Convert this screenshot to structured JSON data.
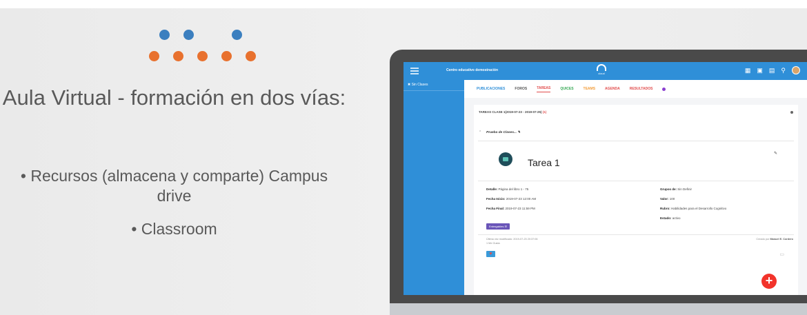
{
  "slide": {
    "title": "Aula Virtual - formación en dos vías:",
    "bullets": [
      "• Recursos (almacena y comparte) Campus drive",
      "• Classroom"
    ],
    "dot_colors": {
      "blue": "#3b7fbf",
      "orange": "#e8712e"
    }
  },
  "app": {
    "topbar": {
      "center_name": "Centro educativo demostración",
      "logo_text": "cloud",
      "icons": [
        "grid-icon",
        "doc-icon",
        "calendar-icon",
        "search-icon",
        "avatar"
      ],
      "color": "#2f8fd8"
    },
    "sidebar": {
      "items": [
        {
          "label": "Sin Clases",
          "icon": "x-icon"
        }
      ]
    },
    "tabs": [
      {
        "label": "PUBLICACIONES",
        "color": "#2f8fd8"
      },
      {
        "label": "FOROS",
        "color": "#555555"
      },
      {
        "label": "TAREAS",
        "color": "#e14b4b"
      },
      {
        "label": "QUICES",
        "color": "#34a853"
      },
      {
        "label": "TEAMS",
        "color": "#f29c38"
      },
      {
        "label": "AGENDA",
        "color": "#e14b4b"
      },
      {
        "label": "RESULTADOS",
        "color": "#e14b4b"
      }
    ],
    "card": {
      "header": "TAREAS CLASE 1(2019-07-23 - 2019-07-25)",
      "header_count": "(1)",
      "subtitle": "Prueba de Clases...",
      "task_title": "Tarea 1",
      "details_left": [
        {
          "label": "Detalle:",
          "value": "Página del libro 1 - 75"
        },
        {
          "label": "Fecha Inicio:",
          "value": "2019-07-23 12:00 AM"
        },
        {
          "label": "Fecha Final:",
          "value": "2019-07-23 11:59 PM"
        }
      ],
      "details_right": [
        {
          "label": "Grupos de:",
          "value": "Sin Definir"
        },
        {
          "label": "Valor:",
          "value": "100"
        },
        {
          "label": "Rubro:",
          "value": "Habilidades para el Desarrollo Cognitivo"
        },
        {
          "label": "Estado:",
          "value": "activo"
        }
      ],
      "deliver_button": "Entregables ☰",
      "last_modified": "Última vez modificado: 2019-07-23 20:37:06",
      "likes": "1 Me Gusta",
      "created_by_label": "Creado por",
      "created_by_name": "Manuel E. Cordero"
    },
    "fab_label": "+"
  }
}
